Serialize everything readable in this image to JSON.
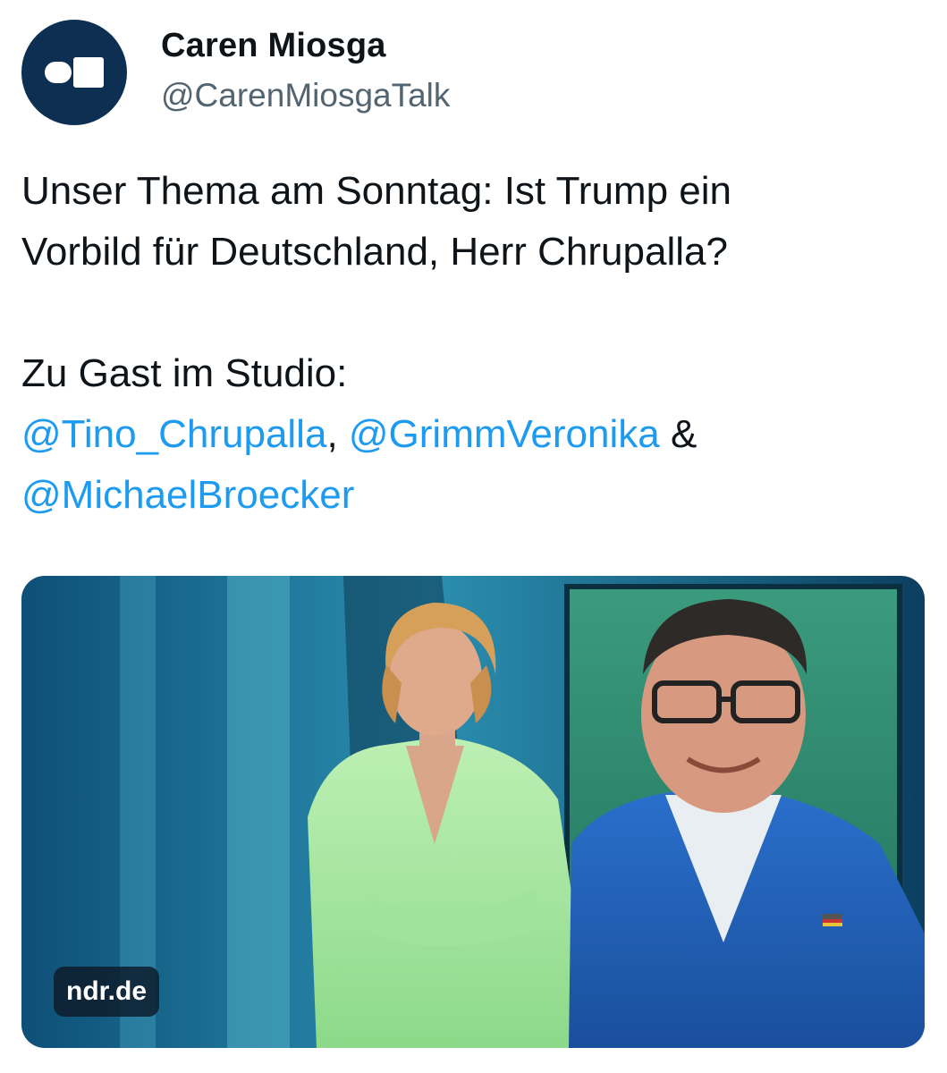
{
  "author": {
    "name": "Caren Miosga",
    "handle": "@CarenMiosgaTalk",
    "avatar_icon": "caren-miosga-logo-icon"
  },
  "tweet": {
    "line1": "Unser Thema am Sonntag: Ist Trump ein",
    "line2": "Vorbild für Deutschland, Herr Chrupalla?",
    "guests_intro": "Zu Gast im Studio:",
    "mention1": "@Tino_Chrupalla",
    "sep1": ", ",
    "mention2": "@GrimmVeronika",
    "sep2": " &",
    "mention3": "@MichaelBroecker"
  },
  "media": {
    "source_label": "ndr.de"
  },
  "colors": {
    "mention": "#1d9bf0",
    "avatar_bg": "#0d2f52"
  }
}
